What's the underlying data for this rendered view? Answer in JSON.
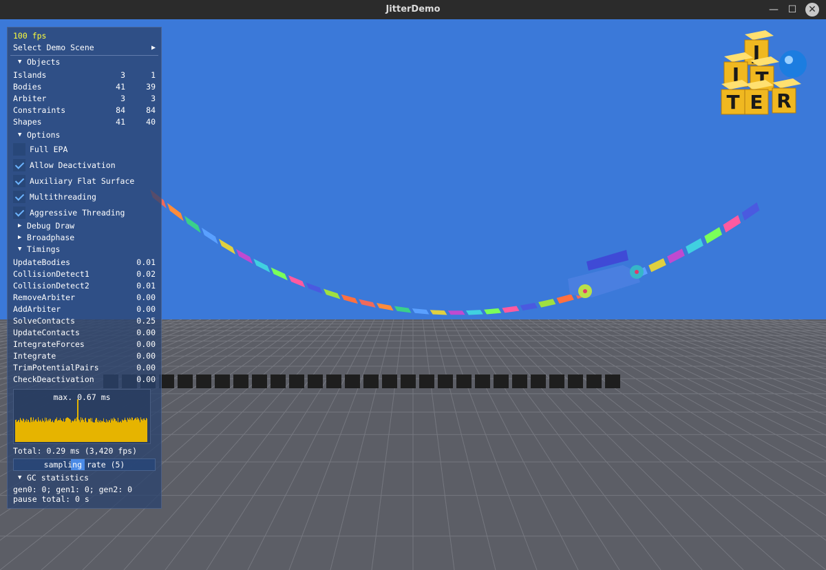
{
  "window": {
    "title": "JitterDemo",
    "minimize": "—",
    "maximize": "☐",
    "close": "✕"
  },
  "logo": {
    "letters": [
      "J",
      "I",
      "T",
      "T",
      "E",
      "R"
    ]
  },
  "panel": {
    "fps": "100 fps",
    "select_scene": "Select Demo Scene",
    "select_arrow": "▶",
    "objects": {
      "header": "Objects",
      "arrow": "▼",
      "rows": [
        {
          "label": "Islands",
          "v1": "3",
          "v2": "1"
        },
        {
          "label": "Bodies",
          "v1": "41",
          "v2": "39"
        },
        {
          "label": "Arbiter",
          "v1": "3",
          "v2": "3"
        },
        {
          "label": "Constraints",
          "v1": "84",
          "v2": "84"
        },
        {
          "label": "Shapes",
          "v1": "41",
          "v2": "40"
        }
      ]
    },
    "options": {
      "header": "Options",
      "arrow": "▼",
      "checkboxes": [
        {
          "label": "Full EPA",
          "checked": false
        },
        {
          "label": "Allow Deactivation",
          "checked": true
        },
        {
          "label": "Auxiliary Flat Surface",
          "checked": true
        },
        {
          "label": "Multithreading",
          "checked": true
        },
        {
          "label": "Aggressive Threading",
          "checked": true
        }
      ]
    },
    "debug_draw": {
      "header": "Debug Draw",
      "arrow": "▶"
    },
    "broadphase": {
      "header": "Broadphase",
      "arrow": "▶"
    },
    "timings": {
      "header": "Timings",
      "arrow": "▼",
      "rows": [
        {
          "label": "UpdateBodies",
          "value": "0.01"
        },
        {
          "label": "CollisionDetect1",
          "value": "0.02"
        },
        {
          "label": "CollisionDetect2",
          "value": "0.01"
        },
        {
          "label": "RemoveArbiter",
          "value": "0.00"
        },
        {
          "label": "AddArbiter",
          "value": "0.00"
        },
        {
          "label": "SolveContacts",
          "value": "0.25"
        },
        {
          "label": "UpdateContacts",
          "value": "0.00"
        },
        {
          "label": "IntegrateForces",
          "value": "0.00"
        },
        {
          "label": "Integrate",
          "value": "0.00"
        },
        {
          "label": "TrimPotentialPairs",
          "value": "0.00"
        },
        {
          "label": "CheckDeactivation",
          "value": "0.00"
        }
      ],
      "plot_max": "max. 0.67 ms",
      "total": "Total: 0.29 ms (3,420 fps)",
      "sampling": "sampling rate (5)",
      "sampling_fraction": 0.45
    },
    "gc": {
      "header": "GC statistics",
      "arrow": "▼",
      "line1": "gen0: 0; gen1: 0; gen2: 0",
      "line2": "pause total: 0 s"
    }
  },
  "colors": {
    "sky": "#3b79d9",
    "floor": "#5c5e66",
    "grid": "#8a8c94",
    "plot_fill": "#e6b400",
    "fps_text": "#ffff3a"
  }
}
